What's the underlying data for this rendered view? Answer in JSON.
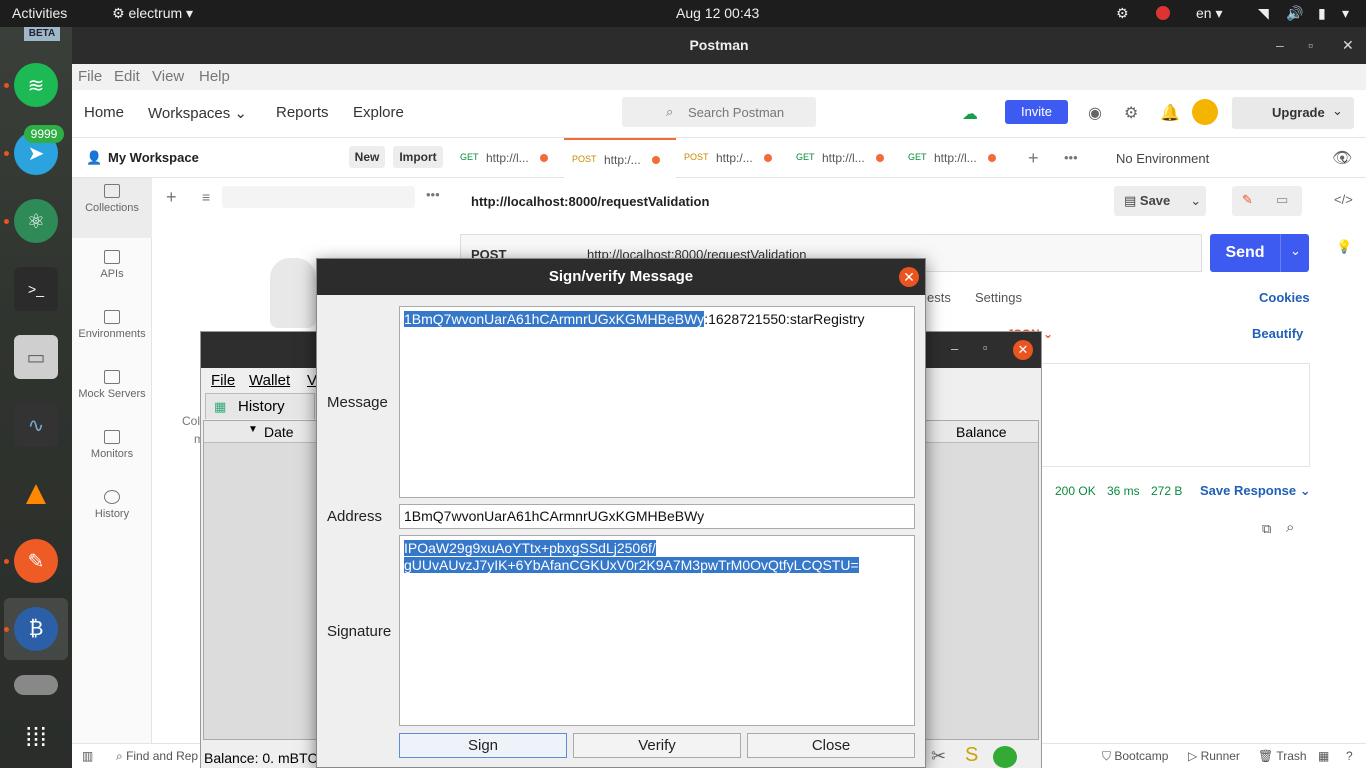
{
  "topbar": {
    "activities": "Activities",
    "app_name": "electrum",
    "clock": "Aug 12  00:43",
    "lang": "en"
  },
  "dock": {
    "beta_label": "BETA",
    "telegram_badge": "9999"
  },
  "postman": {
    "window_title": "Postman",
    "menu": [
      "File",
      "Edit",
      "View",
      "Help"
    ],
    "nav": [
      "Home",
      "Workspaces",
      "Reports",
      "Explore"
    ],
    "search_placeholder": "Search Postman",
    "invite": "Invite",
    "upgrade": "Upgrade",
    "workspace": "My Workspace",
    "new_btn": "New",
    "import_btn": "Import",
    "rail": [
      "Collections",
      "APIs",
      "Environments",
      "Mock Servers",
      "Monitors",
      "History"
    ],
    "tabs": [
      {
        "method": "GET",
        "url": "http://l..."
      },
      {
        "method": "POST",
        "url": "http:/..."
      },
      {
        "method": "POST",
        "url": "http:/..."
      },
      {
        "method": "GET",
        "url": "http://l..."
      },
      {
        "method": "GET",
        "url": "http://l..."
      }
    ],
    "environment": "No Environment",
    "request_title": "http://localhost:8000/requestValidation",
    "save": "Save",
    "method": "POST",
    "request_url": "http://localhost:8000/requestValidation",
    "send": "Send",
    "req_tabs": [
      "ests",
      "Settings"
    ],
    "cookies": "Cookies",
    "beautify": "Beautify",
    "body_fmt": "JSON",
    "status": "200 OK",
    "time": "36 ms",
    "size": "272 B",
    "save_response": "Save Response",
    "footer": [
      "Find and Rep",
      "Bootcamp",
      "Runner",
      "Trash"
    ],
    "collection_hint": "Col",
    "collection_hint2": "m"
  },
  "electrum": {
    "menu": [
      "File",
      "Wallet",
      "V"
    ],
    "history_tab": "History",
    "col_date": "Date",
    "col_balance": "Balance",
    "status": "Balance: 0. mBTC"
  },
  "dialog": {
    "title": "Sign/verify Message",
    "message_label": "Message",
    "message_selected": "1BmQ7wvonUarA61hCArmnrUGxKGMHBeBWy",
    "message_rest": ":1628721550:starRegistry",
    "address_label": "Address",
    "address_value": "1BmQ7wvonUarA61hCArmnrUGxKGMHBeBWy",
    "signature_label": "Signature",
    "signature_line1": "IPOaW29g9xuAoYTtx+pbxgSSdLj2506f/",
    "signature_line2": "gUUvAUvzJ7yIK+6YbAfanCGKUxV0r2K9A7M3pwTrM0OvQtfyLCQSTU=",
    "sign": "Sign",
    "verify": "Verify",
    "close": "Close"
  }
}
